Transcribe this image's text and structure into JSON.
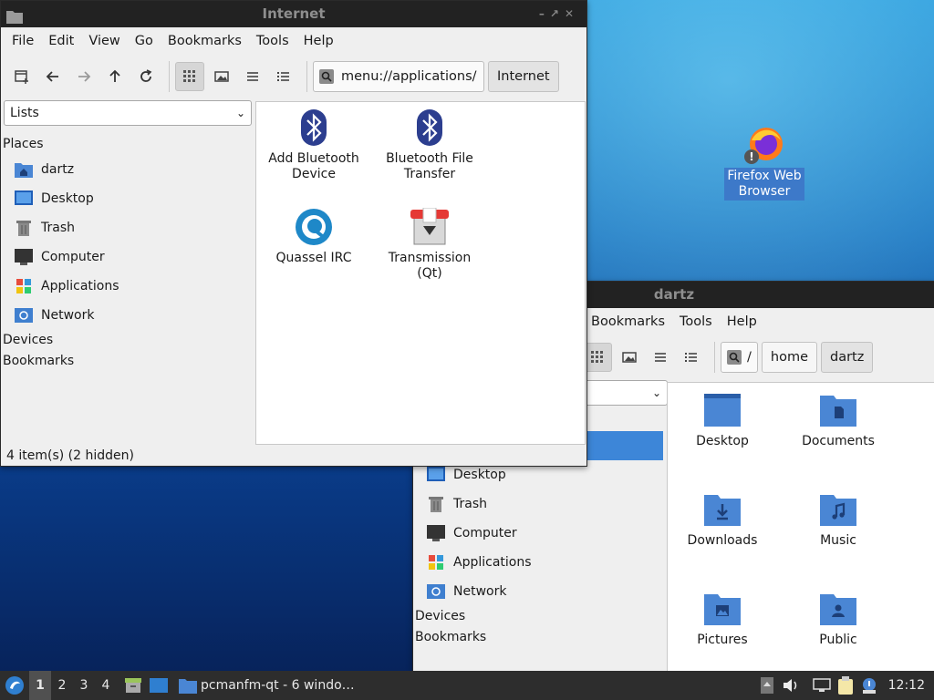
{
  "desktop": {
    "icons": [
      {
        "label": "Firefox Web Browser",
        "icon": "firefox-icon"
      }
    ]
  },
  "window_internet": {
    "title": "Internet",
    "menu": [
      "File",
      "Edit",
      "View",
      "Go",
      "Bookmarks",
      "Tools",
      "Help"
    ],
    "path": "menu://applications/",
    "path_button": "Internet",
    "side_select": "Lists",
    "sections": {
      "places": "Places",
      "devices": "Devices",
      "bookmarks": "Bookmarks"
    },
    "places": [
      "dartz",
      "Desktop",
      "Trash",
      "Computer",
      "Applications",
      "Network"
    ],
    "items": [
      {
        "label": "Add Bluetooth Device",
        "icon": "bluetooth-icon"
      },
      {
        "label": "Bluetooth File Transfer",
        "icon": "bluetooth-icon"
      },
      {
        "label": "Quassel IRC",
        "icon": "quassel-icon"
      },
      {
        "label": "Transmission (Qt)",
        "icon": "transmission-icon"
      }
    ],
    "status": "4 item(s) (2 hidden)"
  },
  "window_dartz": {
    "title": "dartz",
    "menu_visible": [
      "Bookmarks",
      "Tools",
      "Help"
    ],
    "path_root": "/",
    "crumbs": [
      "home",
      "dartz"
    ],
    "sections": {
      "devices": "Devices",
      "bookmarks": "Bookmarks"
    },
    "places": [
      "Desktop",
      "Trash",
      "Computer",
      "Applications",
      "Network"
    ],
    "folders": [
      {
        "label": "Desktop",
        "icon": "desktop-folder-icon"
      },
      {
        "label": "Documents",
        "icon": "documents-folder-icon"
      },
      {
        "label": "Downloads",
        "icon": "downloads-folder-icon"
      },
      {
        "label": "Music",
        "icon": "music-folder-icon"
      },
      {
        "label": "Pictures",
        "icon": "pictures-folder-icon"
      },
      {
        "label": "Public",
        "icon": "public-folder-icon"
      }
    ]
  },
  "taskbar": {
    "workspaces": [
      "1",
      "2",
      "3",
      "4"
    ],
    "active_workspace": "1",
    "task": "pcmanfm-qt - 6 windo…",
    "clock": "12:12"
  },
  "colors": {
    "folder_blue": "#4a86d4",
    "bluetooth_navy": "#2c3e8f",
    "selection": "#3d86d8"
  }
}
